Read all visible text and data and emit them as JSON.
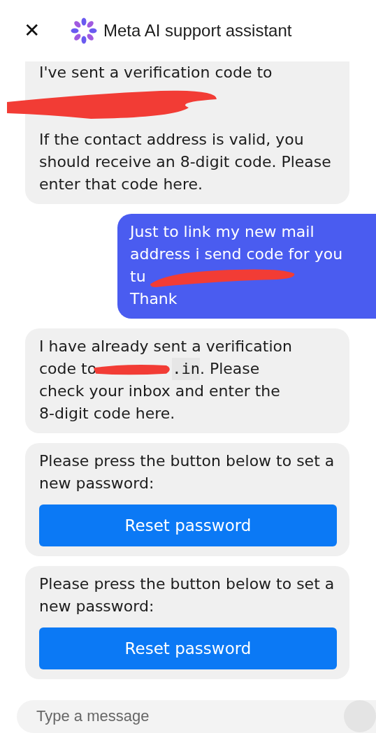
{
  "header": {
    "close": "✕",
    "title": "Meta AI support assistant"
  },
  "messages": [
    {
      "kind": "bot_text",
      "lines": [
        "I've sent a verification code to"
      ],
      "redacted": true,
      "paragraph": "If the contact address is valid, you should receive an 8-digit code. Please enter that code here."
    },
    {
      "kind": "user_text",
      "lines": [
        "Just to link my new mail address i send code for you",
        "tu",
        "Thank"
      ],
      "redacted": true
    },
    {
      "kind": "bot_code",
      "lines_before": [
        "I have already sent a verification"
      ],
      "code_line": {
        "before": "code to",
        "code": ".in",
        "after": ". Please"
      },
      "lines_after": [
        "check your inbox and enter the",
        "8-digit code here."
      ],
      "redacted": true
    },
    {
      "kind": "bot_action",
      "text": "Please press the button below to set a new password:",
      "button": "Reset password"
    },
    {
      "kind": "bot_action",
      "text": "Please press the button below to set a new password:",
      "button": "Reset password"
    }
  ],
  "composer": {
    "placeholder": "Type a message"
  }
}
